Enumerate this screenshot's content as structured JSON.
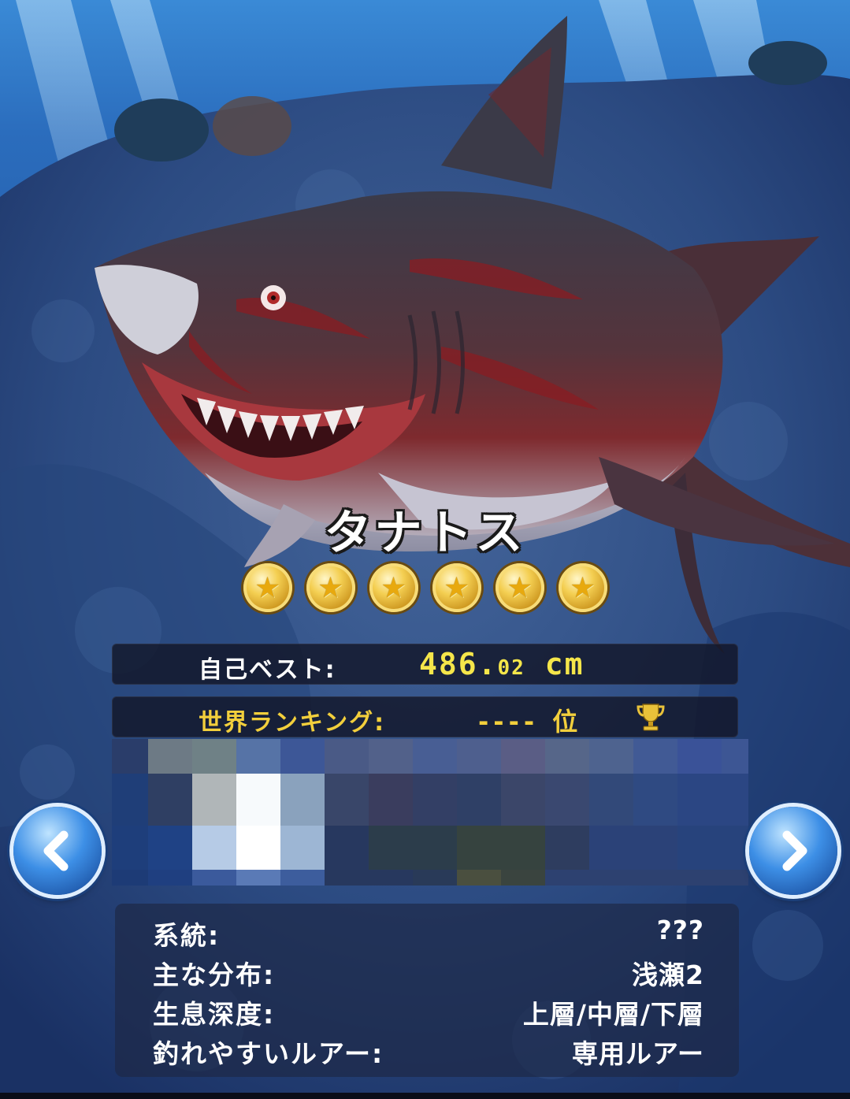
{
  "fish": {
    "name": "タナトス",
    "rating": 6,
    "star_icon": "gold-star-medal-icon"
  },
  "personal_best": {
    "label": "自己ベスト:",
    "value_int": "486.",
    "value_frac": "02",
    "unit": "cm"
  },
  "world_ranking": {
    "label": "世界ランキング:",
    "value": "----",
    "suffix": "位",
    "icon": "trophy-icon"
  },
  "navigation": {
    "prev_icon": "chevron-left-icon",
    "next_icon": "chevron-right-icon"
  },
  "details": [
    {
      "key": "系統:",
      "value": "???"
    },
    {
      "key": "主な分布:",
      "value": "浅瀬2"
    },
    {
      "key": "生息深度:",
      "value": "上層/中層/下層"
    },
    {
      "key": "釣れやすいルアー:",
      "value": "専用ルアー"
    }
  ],
  "colors": {
    "best_value": "#f5e64a",
    "rank_label": "#f2cf3c",
    "button_blue": "#3d8fe6"
  }
}
